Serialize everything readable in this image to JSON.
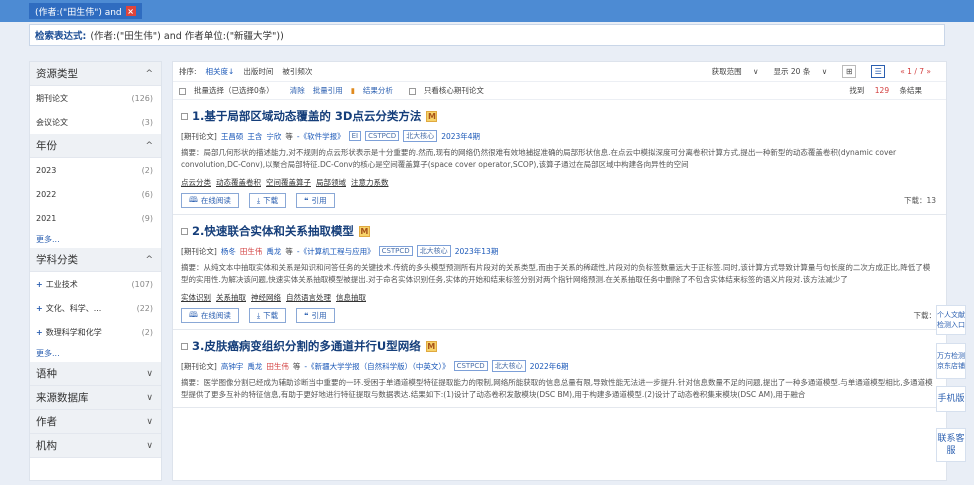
{
  "query_tag": {
    "label": "(作者:(\"田生伟\") and",
    "close": "×"
  },
  "expression": {
    "label": "检索表达式:",
    "value": "(作者:(\"田生伟\") and 作者单位:(\"新疆大学\"))"
  },
  "facets": [
    {
      "title": "资源类型",
      "chev": "^",
      "items": [
        {
          "label": "期刊论文",
          "count": "(126)"
        },
        {
          "label": "会议论文",
          "count": "(3)"
        }
      ]
    },
    {
      "title": "年份",
      "chev": "^",
      "items": [
        {
          "label": "2023",
          "count": "(2)"
        },
        {
          "label": "2022",
          "count": "(6)"
        },
        {
          "label": "2021",
          "count": "(9)"
        }
      ],
      "more": "更多..."
    },
    {
      "title": "学科分类",
      "chev": "^",
      "items": [
        {
          "label": "工业技术",
          "count": "(107)",
          "plus": "+"
        },
        {
          "label": "文化、科学、...",
          "count": "(22)",
          "plus": "+"
        },
        {
          "label": "数理科学和化学",
          "count": "(2)",
          "plus": "+"
        }
      ],
      "more": "更多..."
    },
    {
      "title": "语种",
      "chev": "∨"
    },
    {
      "title": "来源数据库",
      "chev": "∨"
    },
    {
      "title": "作者",
      "chev": "∨"
    },
    {
      "title": "机构",
      "chev": "∨"
    }
  ],
  "sortbar": {
    "label": "排序:",
    "options": [
      "相关度↓",
      "出版时间",
      "被引频次"
    ],
    "range_label": "获取范围",
    "page_size": "显示 20 条",
    "pager": "« 1 / 7 »"
  },
  "batchbar": {
    "select": "批量选择（已选择0条）",
    "clear": "清除",
    "cite": "批量引用",
    "analysis": "结果分析",
    "core_only": "只看核心期刊论文",
    "found_prefix": "找到",
    "found_num": "129",
    "found_suffix": "条结果"
  },
  "results": [
    {
      "title": "1.基于局部区域动态覆盖的 3D点云分类方法",
      "badge": "M",
      "type": "[期刊论文]",
      "authors": [
        {
          "name": "王昌硕",
          "hl": false
        },
        {
          "name": "王含",
          "hl": false
        },
        {
          "name": "宁欣",
          "hl": false
        }
      ],
      "etc": "等",
      "journal": "-《软件学报》",
      "tags": [
        "EI",
        "CSTPCD",
        "北大核心"
      ],
      "date": "2023年4期",
      "abstract": "摘要：局部几何形状的描述能力,对不规则的点云形状表示是十分重要的.然而,现有的网络仍然很难有效地捕捉准确的局部形状信息.在点云中模拟深度可分离卷积计算方式,提出一种新型的动态覆盖卷积(dynamic cover convolution,DC-Conv),以聚合局部特征.DC-Conv的核心是空间覆盖算子(space cover operator,SCOP),该算子通过在局部区域中构建各向异性的空间",
      "keywords": [
        "点云分类",
        "动态覆盖卷积",
        "空间覆盖算子",
        "局部领域",
        "注意力系数"
      ],
      "downloads": "下载：13"
    },
    {
      "title": "2.快速联合实体和关系抽取模型",
      "badge": "M",
      "type": "[期刊论文]",
      "authors": [
        {
          "name": "杨冬",
          "hl": false
        },
        {
          "name": "田生伟",
          "hl": true
        },
        {
          "name": "禹龙",
          "hl": false
        }
      ],
      "etc": "等",
      "journal": "-《计算机工程与应用》",
      "tags": [
        "CSTPCD",
        "北大核心"
      ],
      "date": "2023年13期",
      "abstract": "摘要：从纯文本中抽取实体和关系是知识和问答任务的关键技术.传统的多头模型预测所有片段对的关系类型,而由于关系的稀疏性,片段对的负标签数量远大于正标签.同时,该计算方式导致计算量与句长度的二次方成正比,降低了模型的实用性.为解决该问题,快速实体关系抽取模型被提出.对于命名实体识别任务,实体的开始和结束标签分别对两个指针网络预测.在关系抽取任务中删除了不包含实体结束标签的语义片段对.该方法减少了",
      "keywords": [
        "实体识别",
        "关系抽取",
        "神经网络",
        "自然语言处理",
        "信息抽取"
      ],
      "downloads": "下载："
    },
    {
      "title": "3.皮肤癌病变组织分割的多通道并行U型网络",
      "badge": "M",
      "type": "[期刊论文]",
      "authors": [
        {
          "name": "高钟宇",
          "hl": false
        },
        {
          "name": "禹龙",
          "hl": false
        },
        {
          "name": "田生伟",
          "hl": true
        }
      ],
      "etc": "等",
      "journal": "-《新疆大学学报（自然科学版）（中英文）》",
      "tags": [
        "CSTPCD",
        "北大核心"
      ],
      "date": "2022年6期",
      "abstract": "摘要：医学图像分割已经成为辅助诊断当中重要的一环.受困于单通道模型特征提取能力的限制,网络所能获取的信息总量有限,导致性能无法进一步提升.针对信息数量不足的问题,提出了一种多通道模型.与单通道模型相比,多通道模型提供了更多互补的特征信息,有助于更好地进行特征提取与数据表达.结果如下:(1)设计了动态卷积发散模块(DSC BM),用于构建多通道模型.(2)设计了动态卷积集束模块(DSC AM),用于融合",
      "keywords": [],
      "downloads": ""
    }
  ],
  "actions": {
    "read": "在线阅读",
    "download": "下载",
    "cite": "引用"
  },
  "side": [
    {
      "label": "个人文献检测入口"
    },
    {
      "label": "万方检测京东店铺"
    },
    {
      "label": "手机版"
    },
    {
      "label": "联系客服"
    }
  ]
}
